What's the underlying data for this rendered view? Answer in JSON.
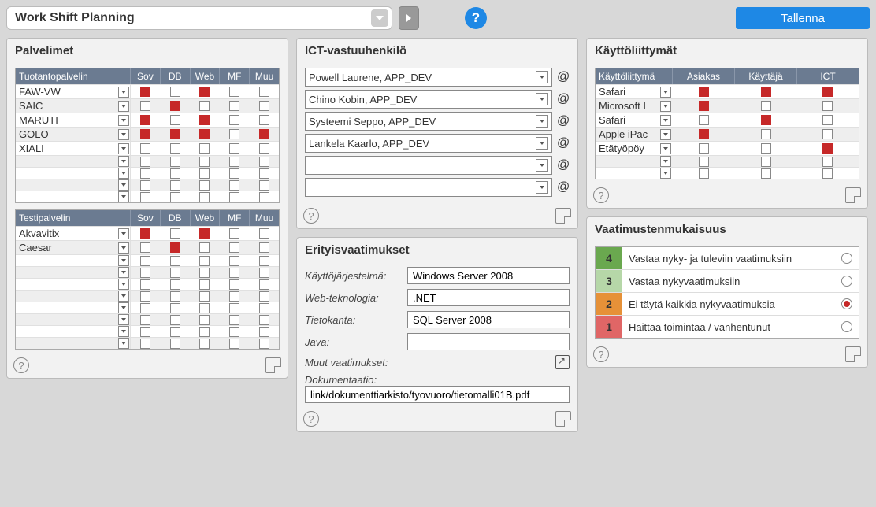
{
  "topbar": {
    "title": "Work Shift Planning",
    "save_label": "Tallenna",
    "help_label": "?"
  },
  "panels": {
    "servers_title": "Palvelimet",
    "ict_title": "ICT-vastuuhenkilö",
    "ui_title": "Käyttöliittymät",
    "req_title": "Erityisvaatimukset",
    "comp_title": "Vaatimustenmukaisuus"
  },
  "servers": {
    "cols": [
      "Sov",
      "DB",
      "Web",
      "MF",
      "Muu"
    ],
    "prod_header": "Tuotantopalvelin",
    "prod_rows": [
      {
        "name": "FAW-VW",
        "v": [
          true,
          false,
          true,
          false,
          false
        ]
      },
      {
        "name": "SAIC",
        "v": [
          false,
          true,
          false,
          false,
          false
        ]
      },
      {
        "name": "MARUTI",
        "v": [
          true,
          false,
          true,
          false,
          false
        ]
      },
      {
        "name": "GOLO",
        "v": [
          true,
          true,
          true,
          false,
          true
        ]
      },
      {
        "name": "XIALI",
        "v": [
          false,
          false,
          false,
          false,
          false
        ]
      },
      {
        "name": "",
        "v": [
          false,
          false,
          false,
          false,
          false
        ]
      },
      {
        "name": "",
        "v": [
          false,
          false,
          false,
          false,
          false
        ]
      },
      {
        "name": "",
        "v": [
          false,
          false,
          false,
          false,
          false
        ]
      },
      {
        "name": "",
        "v": [
          false,
          false,
          false,
          false,
          false
        ]
      }
    ],
    "test_header": "Testipalvelin",
    "test_rows": [
      {
        "name": "Akvavitix",
        "v": [
          true,
          false,
          true,
          false,
          false
        ]
      },
      {
        "name": "Caesar",
        "v": [
          false,
          true,
          false,
          false,
          false
        ]
      },
      {
        "name": "",
        "v": [
          false,
          false,
          false,
          false,
          false
        ]
      },
      {
        "name": "",
        "v": [
          false,
          false,
          false,
          false,
          false
        ]
      },
      {
        "name": "",
        "v": [
          false,
          false,
          false,
          false,
          false
        ]
      },
      {
        "name": "",
        "v": [
          false,
          false,
          false,
          false,
          false
        ]
      },
      {
        "name": "",
        "v": [
          false,
          false,
          false,
          false,
          false
        ]
      },
      {
        "name": "",
        "v": [
          false,
          false,
          false,
          false,
          false
        ]
      },
      {
        "name": "",
        "v": [
          false,
          false,
          false,
          false,
          false
        ]
      },
      {
        "name": "",
        "v": [
          false,
          false,
          false,
          false,
          false
        ]
      }
    ]
  },
  "ict": [
    "Powell Laurene, APP_DEV",
    "Chino Kobin, APP_DEV",
    "Systeemi Seppo, APP_DEV",
    "Lankela Kaarlo, APP_DEV",
    "",
    ""
  ],
  "ui": {
    "cols_header": "Käyttöliittymä",
    "cols": [
      "Asiakas",
      "Käyttäjä",
      "ICT"
    ],
    "rows": [
      {
        "name": "Safari",
        "v": [
          true,
          true,
          true
        ]
      },
      {
        "name": "Microsoft I",
        "v": [
          true,
          false,
          false
        ]
      },
      {
        "name": "Safari",
        "v": [
          false,
          true,
          false
        ]
      },
      {
        "name": "Apple iPac",
        "v": [
          true,
          false,
          false
        ]
      },
      {
        "name": "Etätyöpöy",
        "v": [
          false,
          false,
          true
        ]
      },
      {
        "name": "",
        "v": [
          false,
          false,
          false
        ]
      },
      {
        "name": "",
        "v": [
          false,
          false,
          false
        ]
      }
    ]
  },
  "requirements": {
    "os_label": "Käyttöjärjestelmä:",
    "os_value": "Windows Server 2008",
    "web_label": "Web-teknologia:",
    "web_value": ".NET",
    "db_label": "Tietokanta:",
    "db_value": "SQL Server 2008",
    "java_label": "Java:",
    "java_value": "",
    "other_label": "Muut vaatimukset:",
    "doc_label": "Dokumentaatio:",
    "doc_value": "link/dokumenttiarkisto/tyovuoro/tietomalli01B.pdf"
  },
  "compliance": [
    {
      "n": "4",
      "color": "#6aa84f",
      "text": "Vastaa nyky- ja tuleviin vaatimuksiin",
      "sel": false
    },
    {
      "n": "3",
      "color": "#b6d7a8",
      "text": "Vastaa nykyvaatimuksiin",
      "sel": false
    },
    {
      "n": "2",
      "color": "#e69138",
      "text": "Ei täytä kaikkia nykyvaatimuksia",
      "sel": true
    },
    {
      "n": "1",
      "color": "#e06666",
      "text": "Haittaa toimintaa / vanhentunut",
      "sel": false
    }
  ]
}
